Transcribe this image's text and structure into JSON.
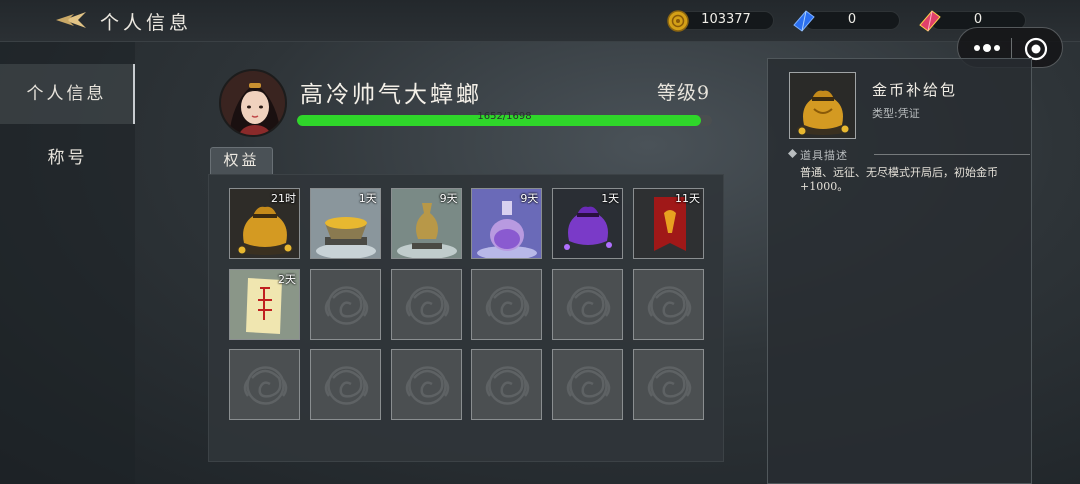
{
  "header": {
    "title": "个人信息",
    "back_icon": "back-arrow-icon",
    "currencies": [
      {
        "icon": "gold-coin-icon",
        "value": "103377"
      },
      {
        "icon": "blue-crystal-icon",
        "value": "0"
      },
      {
        "icon": "pink-crystal-icon",
        "value": "0"
      }
    ]
  },
  "capsule": {
    "more_icon": "more-dots-icon",
    "close_icon": "target-circle-icon"
  },
  "sidebar": {
    "items": [
      {
        "label": "个人信息",
        "active": true
      },
      {
        "label": "称号",
        "active": false
      }
    ]
  },
  "profile": {
    "name": "高冷帅气大蟑螂",
    "level": "等级9",
    "xp_text": "1652/1698",
    "xp_current": 1652,
    "xp_max": 1698
  },
  "benefits": {
    "tab_label": "权益",
    "items": [
      {
        "icon": "gold-pouch-icon",
        "duration": "21时"
      },
      {
        "icon": "treasure-bowl-icon",
        "duration": "1天"
      },
      {
        "icon": "gold-vase-icon",
        "duration": "9天"
      },
      {
        "icon": "purple-potion-icon",
        "duration": "9天"
      },
      {
        "icon": "purple-pouch-icon",
        "duration": "1天"
      },
      {
        "icon": "red-banner-icon",
        "duration": "11天"
      },
      {
        "icon": "talisman-scroll-icon",
        "duration": "2天"
      }
    ],
    "empty_slot_icon": "empty-slot-emblem-icon"
  },
  "detail": {
    "icon": "gold-pouch-icon",
    "name": "金币补给包",
    "type": "类型:凭证",
    "section_title": "道具描述",
    "description": "普通、远征、无尽模式开局后，初始金币+1000。"
  },
  "colors": {
    "xp_fill": "#2fd62a",
    "gold": "#d4a017",
    "accent_pink": "#e0406a"
  }
}
